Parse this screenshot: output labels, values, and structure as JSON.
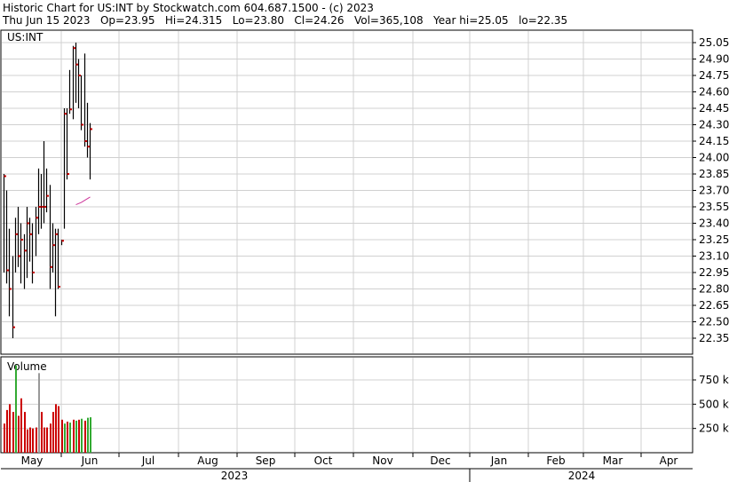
{
  "header": {
    "line1": "Historic Chart for US:INT by Stockwatch.com 604.687.1500 - (c) 2023",
    "line2": "Thu Jun 15 2023   Op=23.95   Hi=24.315   Lo=23.80   Cl=24.26   Vol=365,108   Year hi=25.05   lo=22.35"
  },
  "chart_data": {
    "type": "bar",
    "symbol": "US:INT",
    "volume_title": "Volume",
    "price_ylim": [
      22.25,
      25.1
    ],
    "price_ticks": [
      "25.05",
      "24.90",
      "24.75",
      "24.60",
      "24.45",
      "24.30",
      "24.15",
      "24.00",
      "23.85",
      "23.70",
      "23.55",
      "23.40",
      "23.25",
      "23.10",
      "22.95",
      "22.80",
      "22.65",
      "22.50",
      "22.35"
    ],
    "volume_ylim": [
      0,
      950000
    ],
    "volume_ticks": [
      {
        "value": 750000,
        "label": "750 k"
      },
      {
        "value": 500000,
        "label": "500 k"
      },
      {
        "value": 250000,
        "label": "250 k"
      }
    ],
    "months": [
      "May",
      "Jun",
      "Jul",
      "Aug",
      "Sep",
      "Oct",
      "Nov",
      "Dec",
      "Jan",
      "Feb",
      "Mar",
      "Apr"
    ],
    "years": [
      "2023",
      "2024"
    ],
    "grid": true,
    "colors": {
      "bar": "#000000",
      "close_tick": "#cc0000",
      "vol_up": "#33aa33",
      "vol_down": "#cc0000",
      "vol_neutral": "#999999",
      "grid": "#d0d0d0",
      "ma": "#cc3399"
    },
    "ohlc": [
      {
        "h": 23.85,
        "l": 22.95,
        "c": 23.83
      },
      {
        "h": 23.7,
        "l": 22.85,
        "c": 22.97
      },
      {
        "h": 23.35,
        "l": 22.55,
        "c": 22.8
      },
      {
        "h": 23.1,
        "l": 22.35,
        "c": 22.45
      },
      {
        "h": 23.45,
        "l": 22.95,
        "c": 23.3
      },
      {
        "h": 23.55,
        "l": 23.0,
        "c": 23.1
      },
      {
        "h": 23.4,
        "l": 22.85,
        "c": 23.25
      },
      {
        "h": 23.3,
        "l": 22.8,
        "c": 23.15
      },
      {
        "h": 23.55,
        "l": 22.9,
        "c": 23.4
      },
      {
        "h": 23.45,
        "l": 23.05,
        "c": 23.3
      },
      {
        "h": 23.4,
        "l": 22.85,
        "c": 22.95
      },
      {
        "h": 23.55,
        "l": 23.1,
        "c": 23.45
      },
      {
        "h": 23.9,
        "l": 23.3,
        "c": 23.55
      },
      {
        "h": 23.85,
        "l": 23.35,
        "c": 23.55
      },
      {
        "h": 24.15,
        "l": 23.4,
        "c": 23.55
      },
      {
        "h": 23.9,
        "l": 23.5,
        "c": 23.65
      },
      {
        "h": 23.75,
        "l": 22.8,
        "c": 23.0
      },
      {
        "h": 23.4,
        "l": 22.95,
        "c": 23.2
      },
      {
        "h": 23.35,
        "l": 22.55,
        "c": 23.3
      },
      {
        "h": 23.35,
        "l": 22.8,
        "c": 22.82
      },
      {
        "h": 23.25,
        "l": 23.2,
        "c": 23.24
      },
      {
        "h": 24.45,
        "l": 23.35,
        "c": 24.4
      },
      {
        "h": 24.45,
        "l": 23.8,
        "c": 23.85
      },
      {
        "h": 24.8,
        "l": 24.4,
        "c": 24.44
      },
      {
        "h": 25.02,
        "l": 24.35,
        "c": 25.0
      },
      {
        "h": 25.05,
        "l": 24.5,
        "c": 24.85
      },
      {
        "h": 24.9,
        "l": 24.45,
        "c": 24.75
      },
      {
        "h": 24.75,
        "l": 24.25,
        "c": 24.3
      },
      {
        "h": 24.95,
        "l": 24.1,
        "c": 24.15
      },
      {
        "h": 24.5,
        "l": 24.0,
        "c": 24.1
      },
      {
        "h": 24.315,
        "l": 23.8,
        "c": 24.26
      }
    ],
    "volume": [
      {
        "v": 300000,
        "d": "down"
      },
      {
        "v": 440000,
        "d": "down"
      },
      {
        "v": 500000,
        "d": "down"
      },
      {
        "v": 420000,
        "d": "down"
      },
      {
        "v": 900000,
        "d": "up"
      },
      {
        "v": 380000,
        "d": "down"
      },
      {
        "v": 560000,
        "d": "down"
      },
      {
        "v": 420000,
        "d": "down"
      },
      {
        "v": 240000,
        "d": "down"
      },
      {
        "v": 260000,
        "d": "down"
      },
      {
        "v": 250000,
        "d": "down"
      },
      {
        "v": 260000,
        "d": "down"
      },
      {
        "v": 820000,
        "d": "neutral"
      },
      {
        "v": 420000,
        "d": "down"
      },
      {
        "v": 260000,
        "d": "down"
      },
      {
        "v": 260000,
        "d": "down"
      },
      {
        "v": 300000,
        "d": "down"
      },
      {
        "v": 420000,
        "d": "down"
      },
      {
        "v": 500000,
        "d": "down"
      },
      {
        "v": 480000,
        "d": "down"
      },
      {
        "v": 340000,
        "d": "down"
      },
      {
        "v": 300000,
        "d": "up"
      },
      {
        "v": 320000,
        "d": "down"
      },
      {
        "v": 310000,
        "d": "up"
      },
      {
        "v": 340000,
        "d": "down"
      },
      {
        "v": 330000,
        "d": "up"
      },
      {
        "v": 340000,
        "d": "down"
      },
      {
        "v": 350000,
        "d": "up"
      },
      {
        "v": 330000,
        "d": "down"
      },
      {
        "v": 360000,
        "d": "up"
      },
      {
        "v": 365108,
        "d": "up"
      }
    ],
    "ma": [
      {
        "x": 0,
        "y": 23.57
      },
      {
        "x": 2,
        "y": 23.59
      },
      {
        "x": 5,
        "y": 23.64
      }
    ]
  }
}
